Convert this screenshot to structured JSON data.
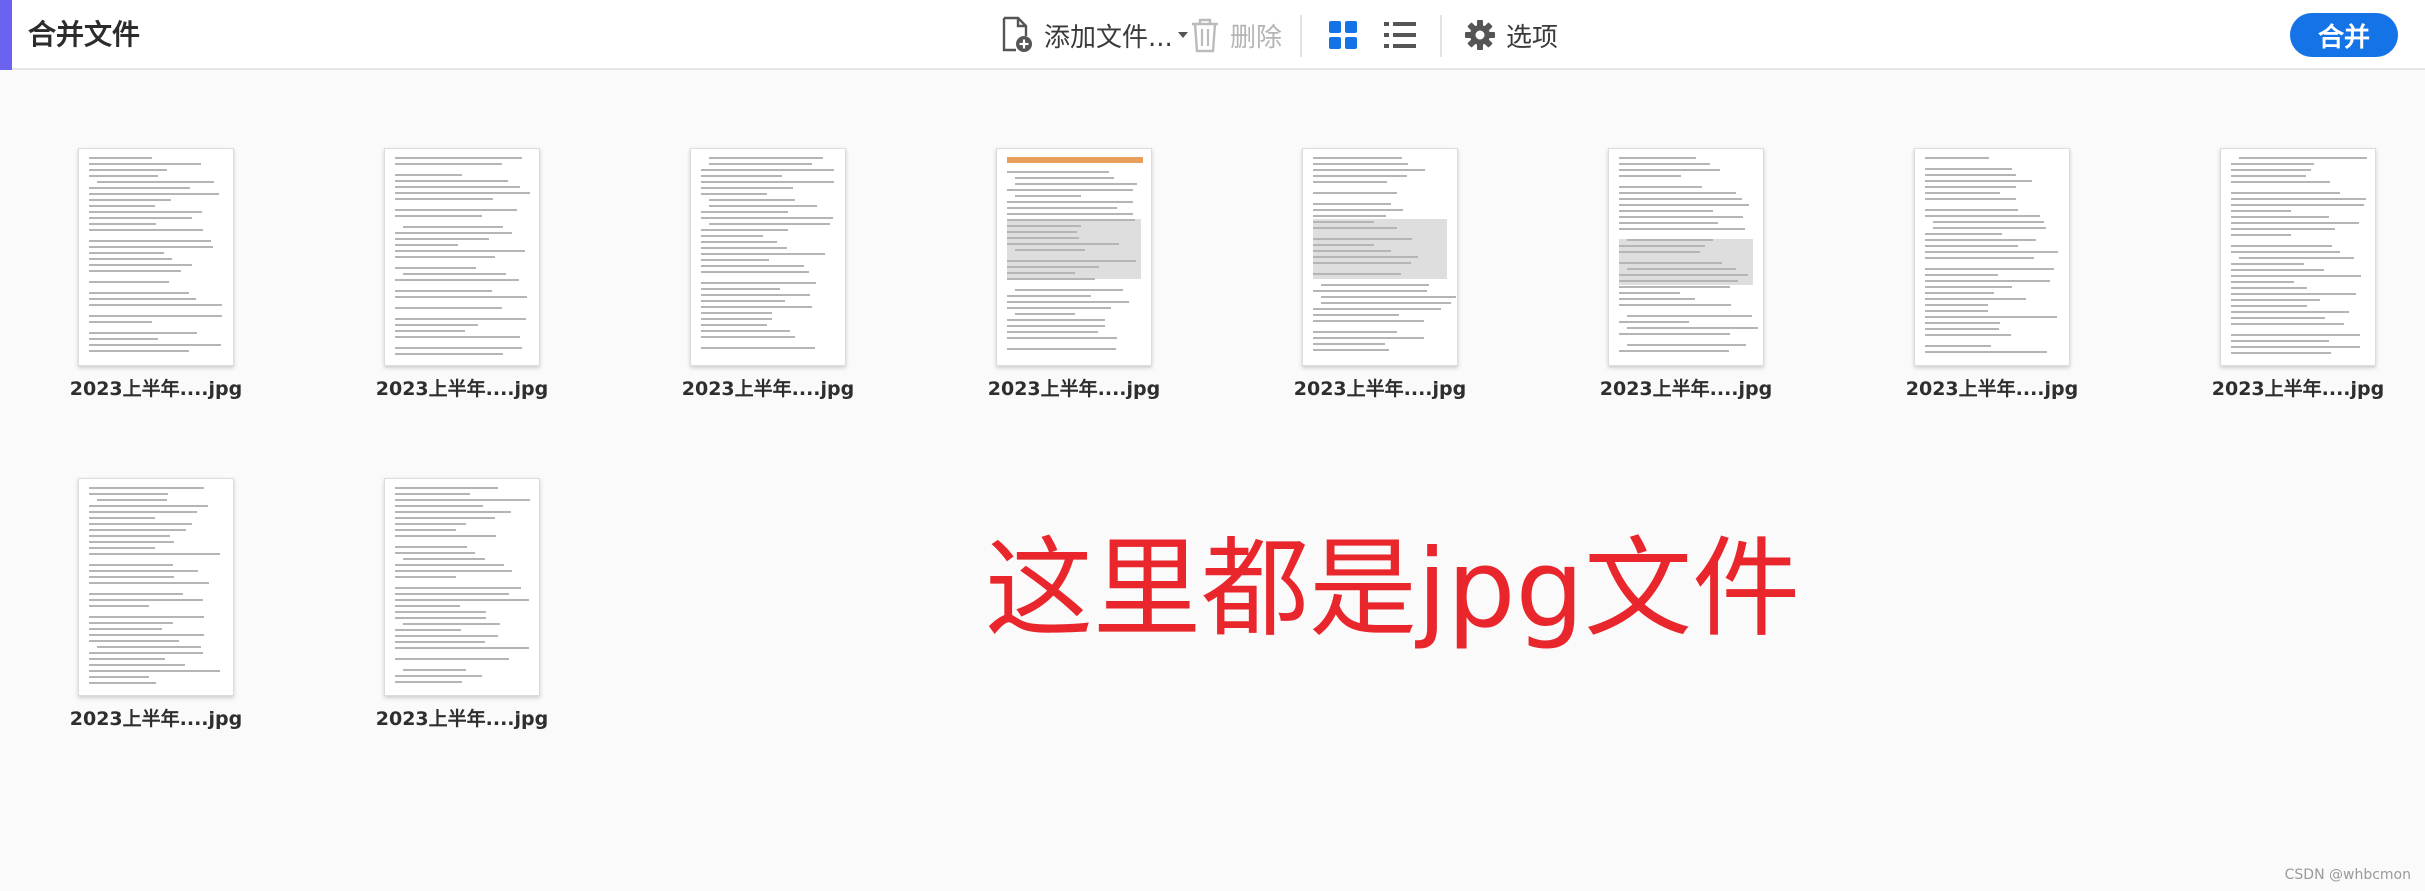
{
  "app": {
    "title": "合并文件"
  },
  "toolbar": {
    "add_files_label": "添加文件...",
    "delete_label": "删除",
    "options_label": "选项",
    "merge_label": "合并",
    "icons": [
      "add-file-icon",
      "dropdown-caret-icon",
      "trash-icon",
      "grid-view-icon",
      "list-view-icon",
      "gear-icon"
    ]
  },
  "files": [
    {
      "name": "2023上半年....jpg"
    },
    {
      "name": "2023上半年....jpg"
    },
    {
      "name": "2023上半年....jpg"
    },
    {
      "name": "2023上半年....jpg"
    },
    {
      "name": "2023上半年....jpg"
    },
    {
      "name": "2023上半年....jpg"
    },
    {
      "name": "2023上半年....jpg"
    },
    {
      "name": "2023上半年....jpg"
    },
    {
      "name": "2023上半年....jpg"
    },
    {
      "name": "2023上半年....jpg"
    }
  ],
  "annotation": {
    "text": "这里都是jpg文件"
  },
  "watermark": {
    "text": "CSDN @whbcmon"
  },
  "colors": {
    "accent": "#6b63f0",
    "primary": "#1473e6",
    "annotation": "#e8262c",
    "view_active": "#1473e6"
  }
}
